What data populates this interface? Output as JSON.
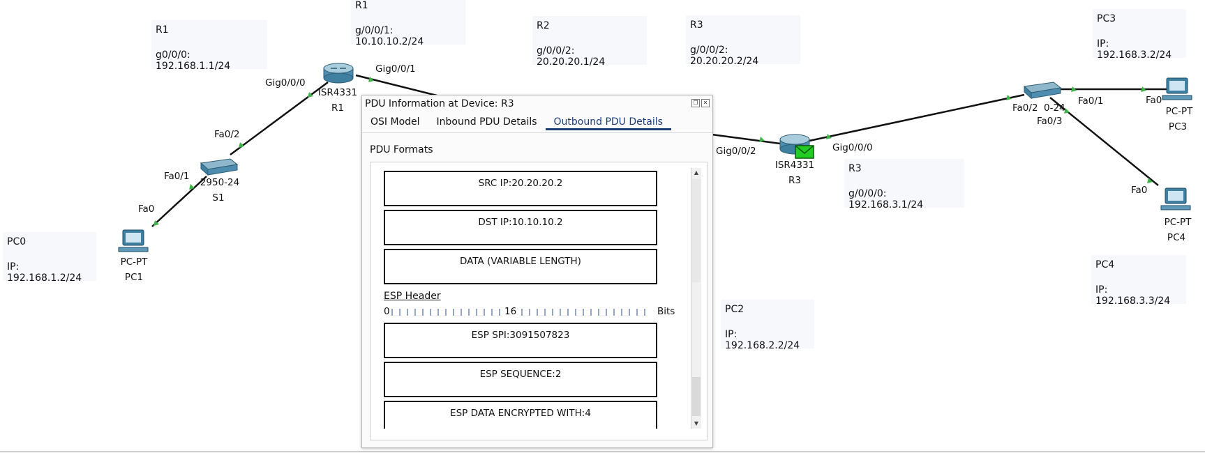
{
  "notes": {
    "pc0": {
      "title": "PC0",
      "ip": "IP: 192.168.1.2/24"
    },
    "r1_a": {
      "title": "R1",
      "ip": "g0/0/0: 192.168.1.1/24"
    },
    "r1_b": {
      "title": "R1",
      "ip": "g/0/0/1: 10.10.10.2/24"
    },
    "r2": {
      "title": "R2",
      "ip": "g/0/0/2: 20.20.20.1/24"
    },
    "r3_a": {
      "title": "R3",
      "ip": "g/0/0/2: 20.20.20.2/24"
    },
    "r3_b": {
      "title": "R3",
      "ip": "g/0/0/0: 192.168.3.1/24"
    },
    "pc2": {
      "title": "PC2",
      "ip": "IP: 192.168.2.2/24"
    },
    "pc3": {
      "title": "PC3",
      "ip": "IP: 192.168.3.2/24"
    },
    "pc4": {
      "title": "PC4",
      "ip": "IP: 192.168.3.3/24"
    }
  },
  "devices": {
    "pc1": {
      "model": "PC-PT",
      "name": "PC1"
    },
    "s1": {
      "model": "2950-24",
      "name": "S1"
    },
    "r1": {
      "model": "ISR4331",
      "name": "R1"
    },
    "r3": {
      "model": "ISR4331",
      "name": "R3"
    },
    "s3": {
      "model": "0-24"
    },
    "pc3": {
      "model": "PC-PT",
      "name": "PC3"
    },
    "pc4": {
      "model": "PC-PT",
      "name": "PC4"
    }
  },
  "ports": {
    "pc1_fa0": "Fa0",
    "s1_fa01": "Fa0/1",
    "s1_fa02": "Fa0/2",
    "r1_gig000": "Gig0/0/0",
    "r1_gig001": "Gig0/0/1",
    "r3_gig002": "Gig0/0/2",
    "r3_gig000": "Gig0/0/0",
    "s3_fa02": "Fa0/2",
    "s3_fa01": "Fa0/1",
    "s3_fa03": "Fa0/3",
    "pc3_fa0": "Fa0",
    "pc4_fa0": "Fa0"
  },
  "dialog": {
    "title": "PDU Information at Device: R3",
    "tabs": [
      "OSI Model",
      "Inbound PDU Details",
      "Outbound PDU Details"
    ],
    "active_tab": "Outbound PDU Details",
    "section": "PDU Formats",
    "ip_fields": [
      "SRC IP:20.20.20.2",
      "DST IP:10.10.10.2",
      "DATA (VARIABLE LENGTH)"
    ],
    "esp_header": "ESP Header",
    "ruler": {
      "start": "0",
      "mid": "16",
      "unit": "Bits"
    },
    "esp_fields": [
      "ESP SPI:3091507823",
      "ESP SEQUENCE:2",
      "ESP DATA ENCRYPTED WITH:4"
    ]
  },
  "colors": {
    "link": "#111111",
    "port_up": "#3fb34a",
    "pdu_envelope": "#22cc22",
    "tab_active": "#1c3b73"
  }
}
